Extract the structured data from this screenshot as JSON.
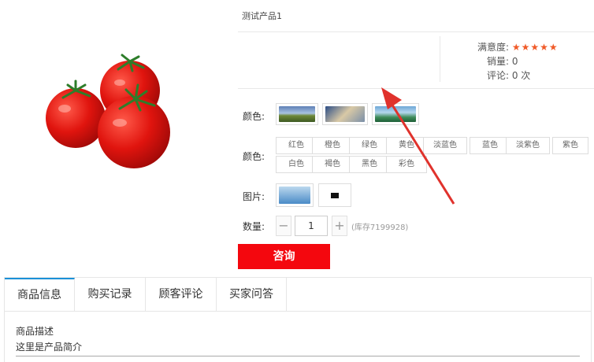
{
  "product": {
    "title": "测试产品1",
    "stats": {
      "satisfaction_label": "满意度:",
      "satisfaction_stars": "★★★★★",
      "sales_label": "销量:",
      "sales_value": "0",
      "reviews_label": "评论:",
      "reviews_value": "0 次"
    },
    "color_image_label": "颜色:",
    "color_image_options": [
      "image-1",
      "image-2",
      "image-3"
    ],
    "color_text_label": "颜色:",
    "color_text_options": [
      "红色",
      "橙色",
      "绿色",
      "黄色",
      "淡蓝色",
      "蓝色",
      "淡紫色",
      "紫色",
      "白色",
      "褐色",
      "黑色",
      "彩色"
    ],
    "picture_label": "图片:",
    "picture_options": [
      "image-a",
      "image-b"
    ],
    "quantity_label": "数量:",
    "quantity_value": "1",
    "quantity_minus": "−",
    "quantity_plus": "+",
    "stock_text": "(库存7199928)",
    "consult_button": "咨询"
  },
  "tabs": [
    "商品信息",
    "购买记录",
    "顾客评论",
    "买家问答"
  ],
  "active_tab": "商品信息",
  "content": {
    "heading": "商品描述",
    "body": "这里是产品简介"
  },
  "colors": {
    "accent_red": "#f4070e",
    "star_orange": "#f05a28",
    "tab_active_blue": "#1a90d8",
    "annotation_arrow": "#e0322c"
  }
}
